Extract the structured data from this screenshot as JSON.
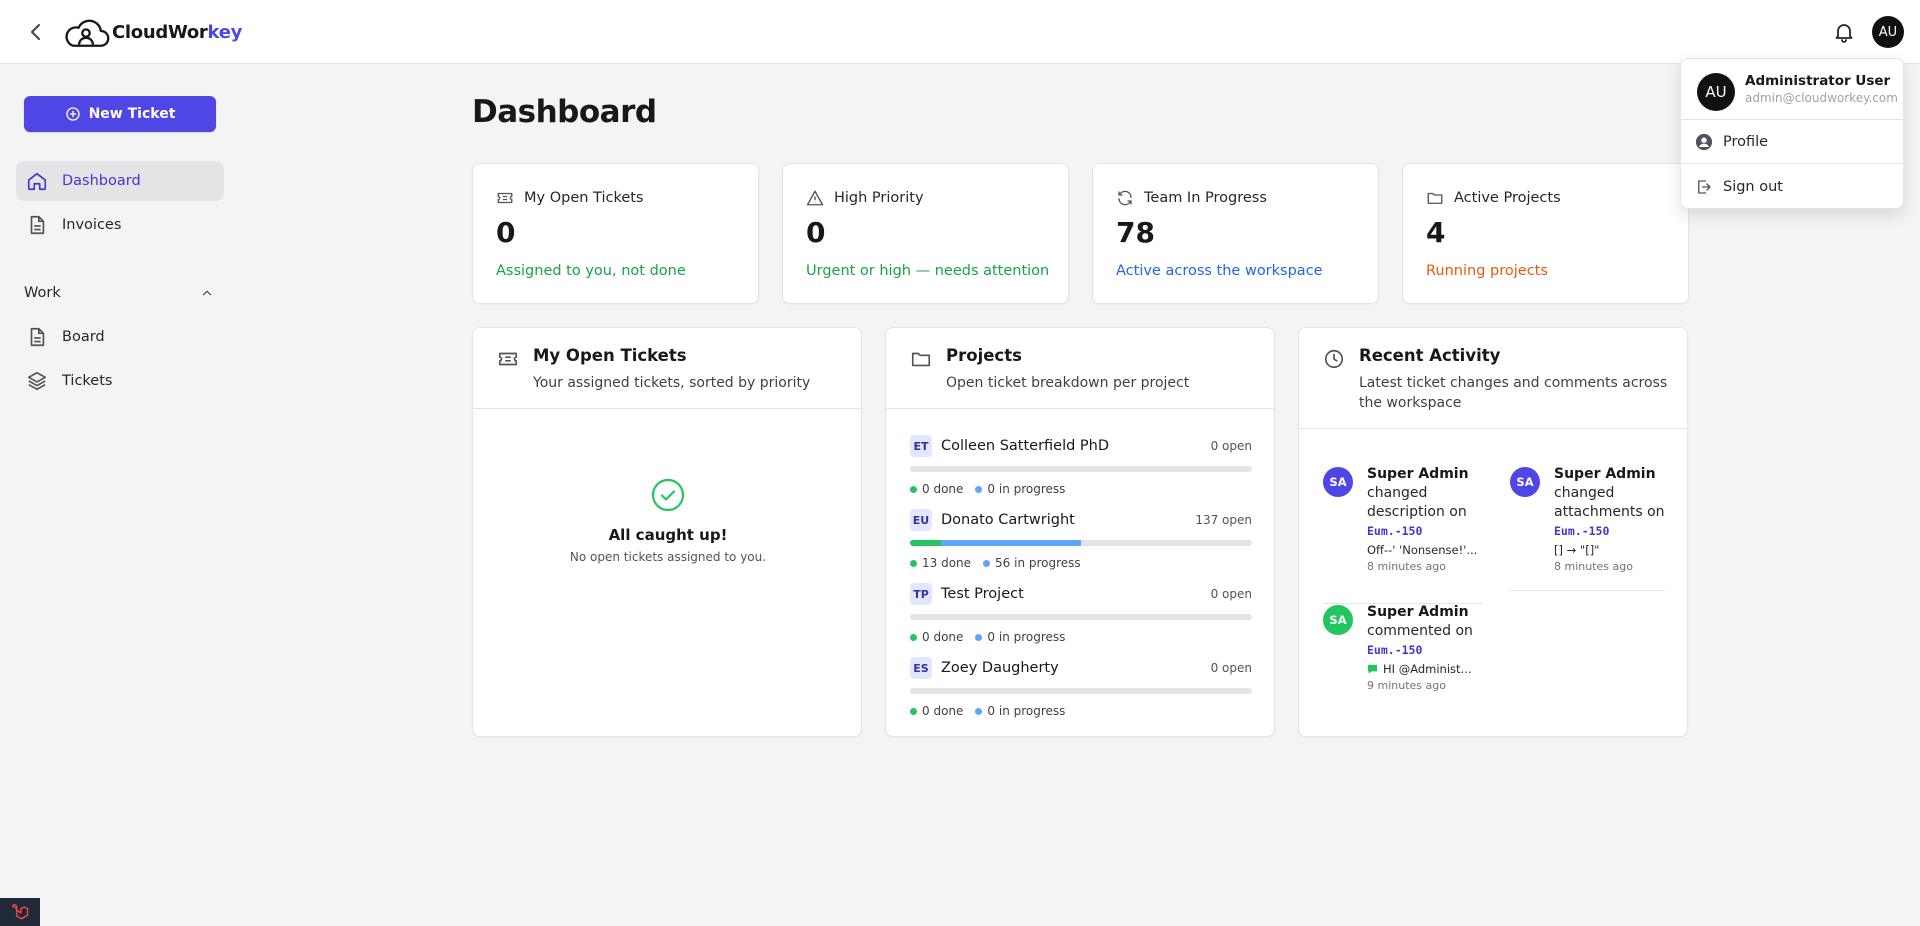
{
  "header": {
    "logo_prefix": "CloudWor",
    "logo_suffix": "key",
    "avatar_initials": "AU"
  },
  "sidebar": {
    "new_ticket_label": "New Ticket",
    "items": [
      {
        "label": "Dashboard",
        "icon": "home-icon",
        "active": true
      },
      {
        "label": "Invoices",
        "icon": "document-icon"
      }
    ],
    "section_label": "Work",
    "work_items": [
      {
        "label": "Board",
        "icon": "document-icon"
      },
      {
        "label": "Tickets",
        "icon": "layers-icon"
      }
    ]
  },
  "page": {
    "title": "Dashboard"
  },
  "stats": [
    {
      "label": "My Open Tickets",
      "value": "0",
      "sub": "Assigned to you, not done",
      "color": "#16a34a",
      "icon": "ticket-icon"
    },
    {
      "label": "High Priority",
      "value": "0",
      "sub": "Urgent or high — needs attention",
      "color": "#16a34a",
      "icon": "warning-icon"
    },
    {
      "label": "Team In Progress",
      "value": "78",
      "sub": "Active across the workspace",
      "color": "#2563eb",
      "icon": "refresh-icon"
    },
    {
      "label": "Active Projects",
      "value": "4",
      "sub": "Running projects",
      "color": "#ea580c",
      "icon": "folder-icon"
    }
  ],
  "panels": {
    "my_tickets": {
      "title": "My Open Tickets",
      "subtitle": "Your assigned tickets, sorted by priority",
      "empty_title": "All caught up!",
      "empty_subtitle": "No open tickets assigned to you."
    },
    "projects": {
      "title": "Projects",
      "subtitle": "Open ticket breakdown per project",
      "items": [
        {
          "code": "ET",
          "name": "Colleen Satterfield PhD",
          "open": "0 open",
          "done": "0 done",
          "in_progress": "0 in progress",
          "done_frac": 0,
          "progress_frac": 0
        },
        {
          "code": "EU",
          "name": "Donato Cartwright",
          "open": "137 open",
          "done": "13 done",
          "in_progress": "56 in progress",
          "done_frac": 0.09,
          "progress_frac": 0.41
        },
        {
          "code": "TP",
          "name": "Test Project",
          "open": "0 open",
          "done": "0 done",
          "in_progress": "0 in progress",
          "done_frac": 0,
          "progress_frac": 0
        },
        {
          "code": "ES",
          "name": "Zoey Daugherty",
          "open": "0 open",
          "done": "0 done",
          "in_progress": "0 in progress",
          "done_frac": 0,
          "progress_frac": 0
        }
      ]
    },
    "activity": {
      "title": "Recent Activity",
      "subtitle": "Latest ticket changes and comments across the workspace",
      "items": [
        {
          "initials": "SA",
          "user": "Super Admin",
          "action": "changed description on",
          "code": "Eum.-150",
          "detail": "Off--' 'Nonsense!'...",
          "time": "8 minutes ago",
          "color": "#4f46e5"
        },
        {
          "initials": "SA",
          "user": "Super Admin",
          "action": "changed attachments on",
          "code": "Eum.-150",
          "detail": "[] → \"[]\"",
          "time": "8 minutes ago",
          "color": "#4f46e5"
        },
        {
          "initials": "SA",
          "user": "Super Admin",
          "action": "commented on",
          "code": "Eum.-150",
          "detail": "HI @Administ...",
          "time": "9 minutes ago",
          "color": "#22c55e"
        }
      ]
    }
  },
  "user_menu": {
    "initials": "AU",
    "name": "Administrator User",
    "email": "admin@cloudworkey.com",
    "items": [
      {
        "label": "Profile",
        "icon": "user-circle-icon"
      },
      {
        "label": "Sign out",
        "icon": "sign-out-icon"
      }
    ]
  }
}
